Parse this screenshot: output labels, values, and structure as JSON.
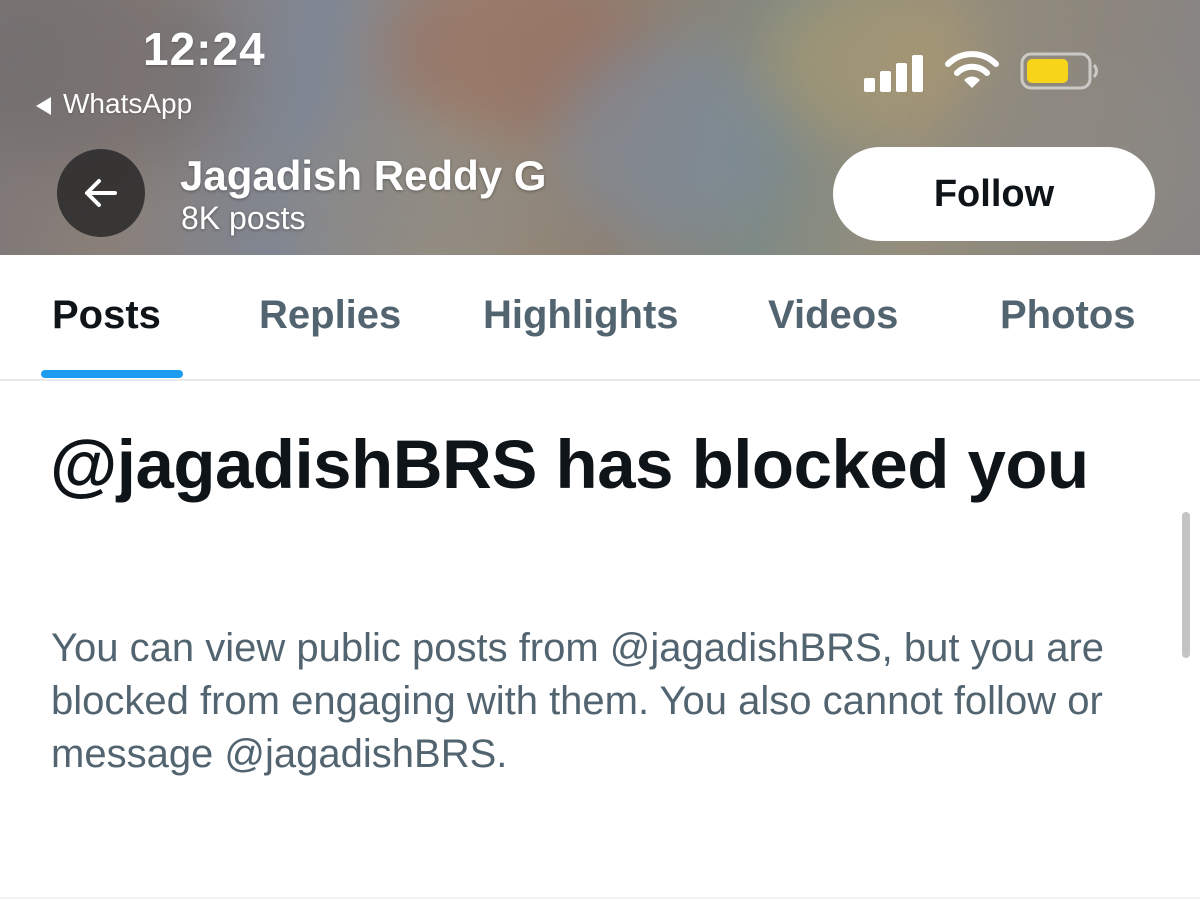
{
  "status_bar": {
    "time": "12:24",
    "back_app_label": "WhatsApp",
    "icons": [
      "cellular-signal-icon",
      "wifi-icon",
      "battery-icon"
    ],
    "battery_level": 0.7,
    "battery_color": "#f7d31a"
  },
  "profile_header": {
    "name": "Jagadish Reddy G",
    "post_count": "8K posts",
    "back_icon": "arrow-left-icon",
    "follow_label": "Follow"
  },
  "tabs": [
    {
      "label": "Posts",
      "active": true
    },
    {
      "label": "Replies",
      "active": false
    },
    {
      "label": "Highlights",
      "active": false
    },
    {
      "label": "Videos",
      "active": false
    },
    {
      "label": "Photos",
      "active": false
    }
  ],
  "blocked_notice": {
    "title": "@jagadishBRS has blocked you",
    "description": "You can view public posts from @jagadishBRS, but you are blocked from engaging with them. You also cannot follow or message @jagadishBRS."
  },
  "colors": {
    "accent": "#1d9bf0",
    "primary_text": "#0f1419",
    "secondary_text": "#536471"
  }
}
